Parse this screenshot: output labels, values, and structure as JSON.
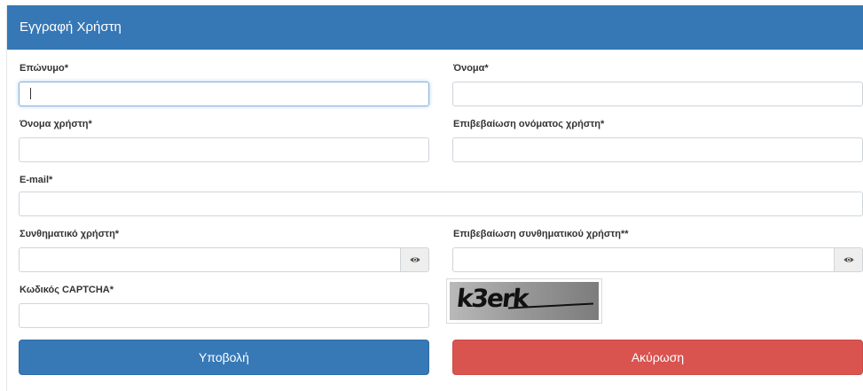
{
  "form": {
    "title": "Εγγραφή Χρήστη",
    "fields": {
      "surname": {
        "label": "Επώνυμο*",
        "value": ""
      },
      "firstname": {
        "label": "Όνομα*",
        "value": ""
      },
      "username": {
        "label": "Όνομα χρήστη*",
        "value": ""
      },
      "username_confirm": {
        "label": "Επιβεβαίωση ονόματος χρήστη*",
        "value": ""
      },
      "email": {
        "label": "E-mail*",
        "value": ""
      },
      "password": {
        "label": "Συνθηματικό χρήστη*",
        "value": ""
      },
      "password_confirm": {
        "label": "Επιβεβαίωση συνθηματικού χρήστη**",
        "value": ""
      },
      "captcha": {
        "label": "Κωδικός CAPTCHA*",
        "value": ""
      }
    },
    "captcha_image_text": "k3erk",
    "buttons": {
      "submit": "Υποβολή",
      "cancel": "Ακύρωση"
    },
    "icons": {
      "show_password": "eye-icon",
      "show_password_confirm": "eye-icon"
    },
    "colors": {
      "header": "#3677b6",
      "primary": "#3779b7",
      "danger": "#d9534f"
    }
  }
}
